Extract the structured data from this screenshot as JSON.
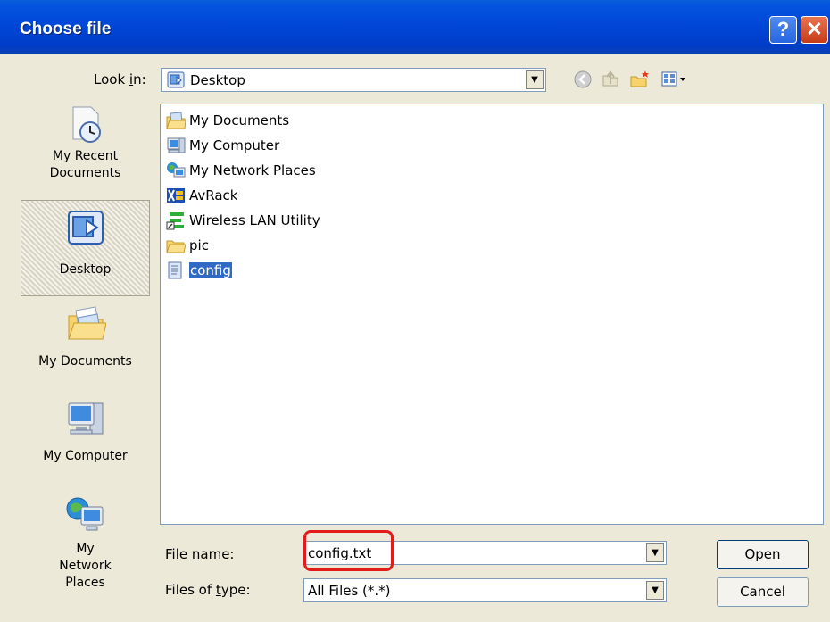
{
  "window": {
    "title": "Choose file",
    "help_glyph": "?",
    "close_glyph": "✕"
  },
  "look_in": {
    "label_pre": "Look ",
    "label_u": "i",
    "label_post": "n:",
    "value": "Desktop",
    "icon": "desktop-icon"
  },
  "toolbar": {
    "icons": [
      "back-icon",
      "up-folder-icon",
      "new-folder-icon",
      "views-menu-icon"
    ]
  },
  "places": [
    {
      "label": "My Recent Documents",
      "icon": "recent-documents-icon",
      "selected": false
    },
    {
      "label": "Desktop",
      "icon": "desktop-icon",
      "selected": true
    },
    {
      "label": "My Documents",
      "icon": "my-documents-icon",
      "selected": false
    },
    {
      "label": "My Computer",
      "icon": "my-computer-icon",
      "selected": false
    },
    {
      "label": "My Network Places",
      "icon": "network-places-icon",
      "selected": false
    }
  ],
  "files": [
    {
      "name": "My Documents",
      "icon": "my-documents-icon"
    },
    {
      "name": "My Computer",
      "icon": "my-computer-icon"
    },
    {
      "name": "My Network Places",
      "icon": "network-places-icon"
    },
    {
      "name": "AvRack",
      "icon": "avrack-icon"
    },
    {
      "name": "Wireless LAN Utility",
      "icon": "wireless-lan-icon"
    },
    {
      "name": "pic",
      "icon": "folder-icon"
    },
    {
      "name": "config",
      "icon": "text-file-icon",
      "selected": true
    }
  ],
  "file_name": {
    "label_pre": "File ",
    "label_u": "n",
    "label_post": "ame:",
    "value": "config.txt"
  },
  "file_type": {
    "label_pre": "Files of ",
    "label_u": "t",
    "label_post": "ype:",
    "value": "All Files (*.*)"
  },
  "buttons": {
    "open_u": "O",
    "open_rest": "pen",
    "cancel": "Cancel"
  },
  "colors": {
    "title_bar": "#0046d6",
    "selection": "#316ac5",
    "highlight_box": "#e21b1b"
  }
}
